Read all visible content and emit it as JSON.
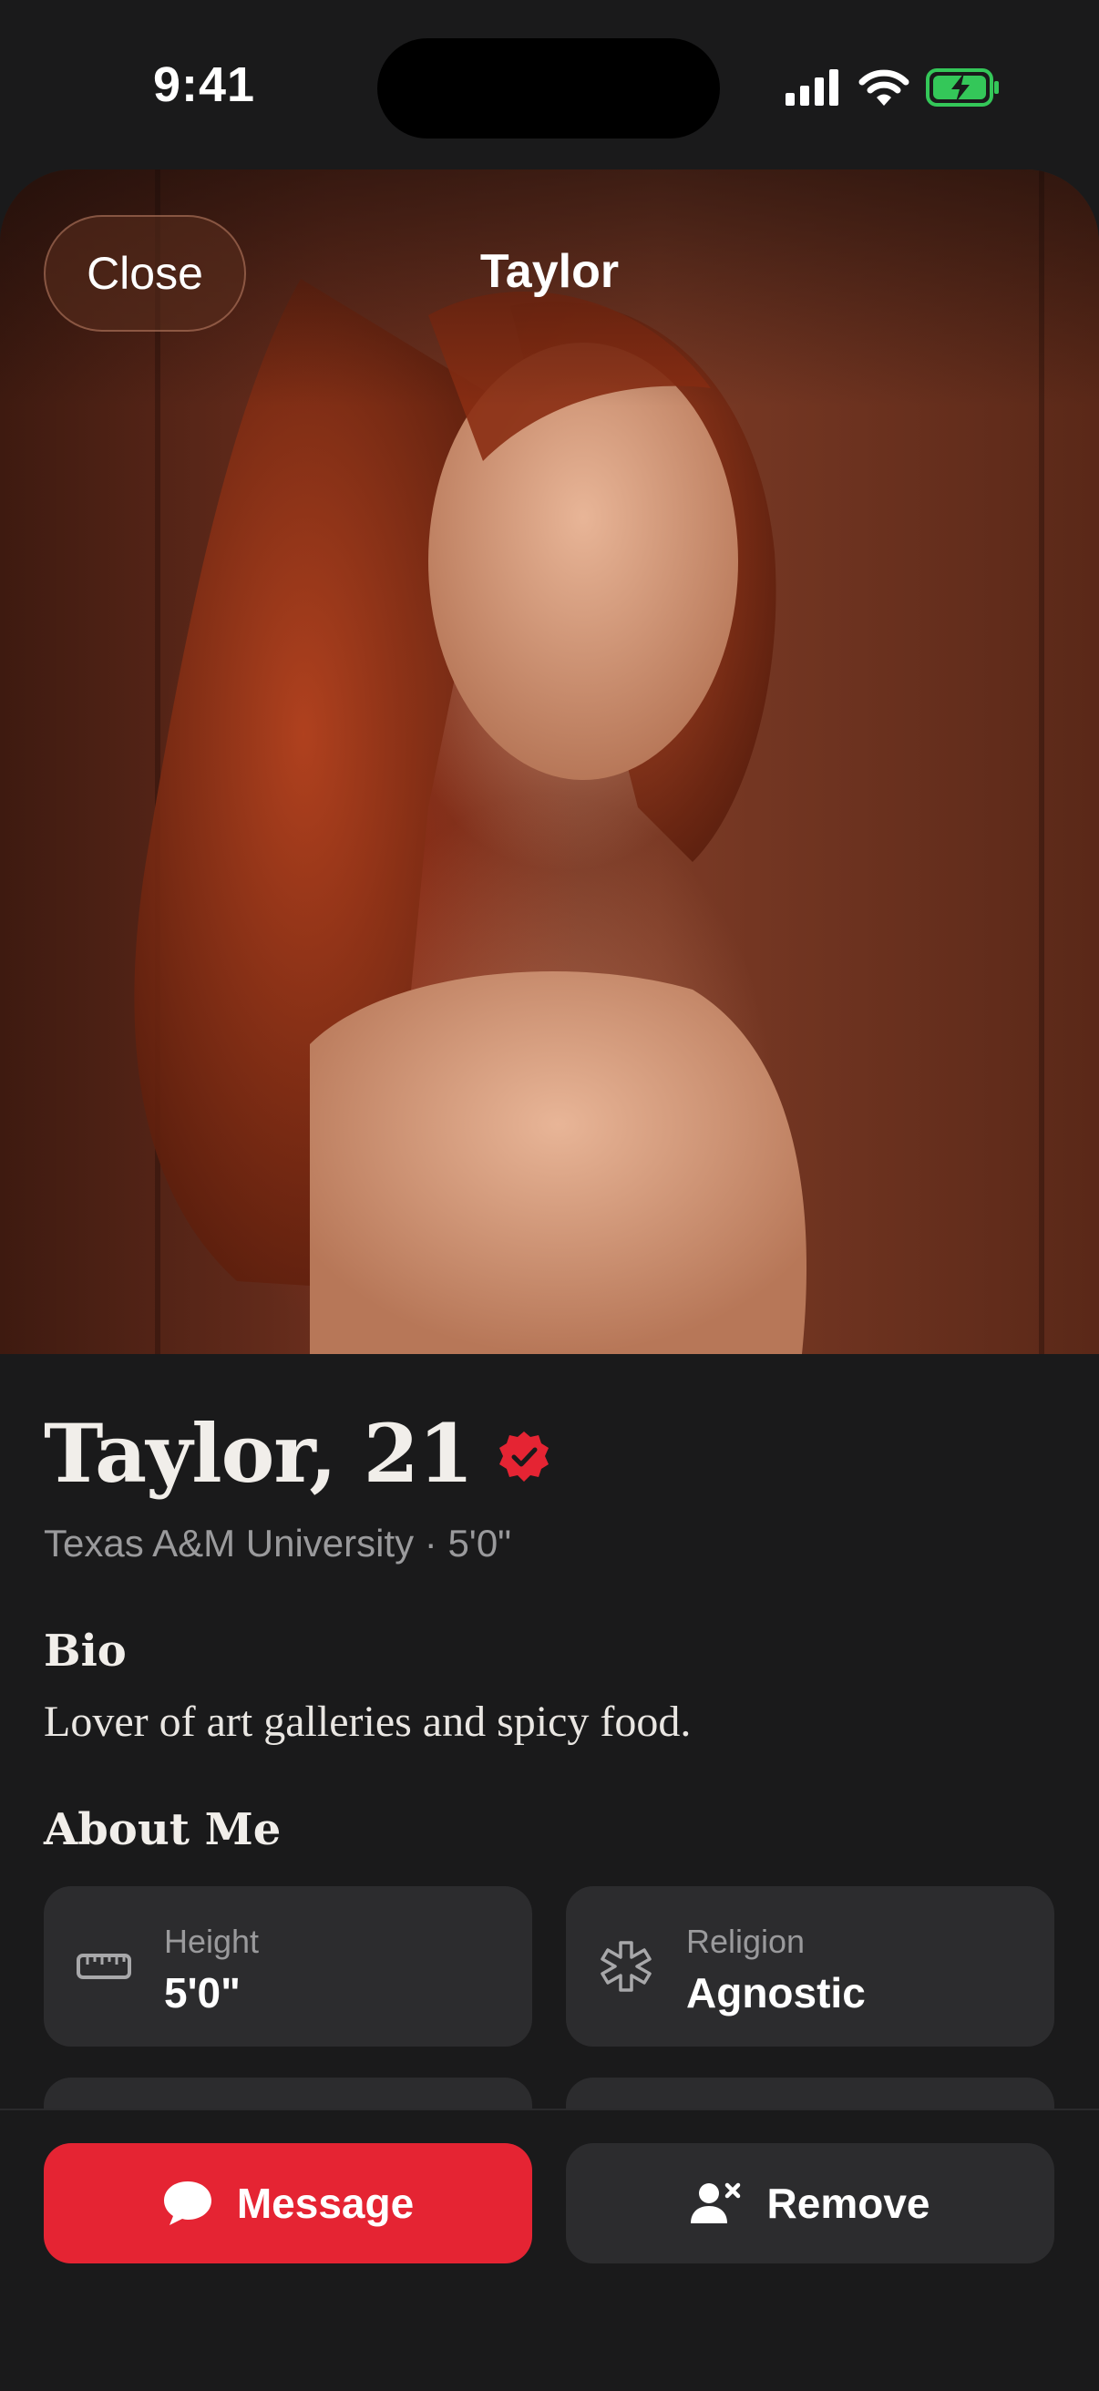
{
  "status_bar": {
    "time": "9:41"
  },
  "header": {
    "close_label": "Close",
    "title": "Taylor"
  },
  "profile": {
    "name_age": "Taylor, 21",
    "subline": "Texas A&M University · 5'0\"",
    "bio_heading": "Bio",
    "bio": "Lover of art galleries and spicy food.",
    "about_heading": "About Me",
    "about": [
      {
        "icon": "ruler-icon",
        "label": "Height",
        "value": "5'0\""
      },
      {
        "icon": "religion-icon",
        "label": "Religion",
        "value": "Agnostic"
      }
    ]
  },
  "actions": {
    "message_label": "Message",
    "remove_label": "Remove"
  },
  "colors": {
    "accent": "#e52433",
    "background": "#1a1a1b",
    "card": "#2c2c2e",
    "battery": "#34c759"
  }
}
